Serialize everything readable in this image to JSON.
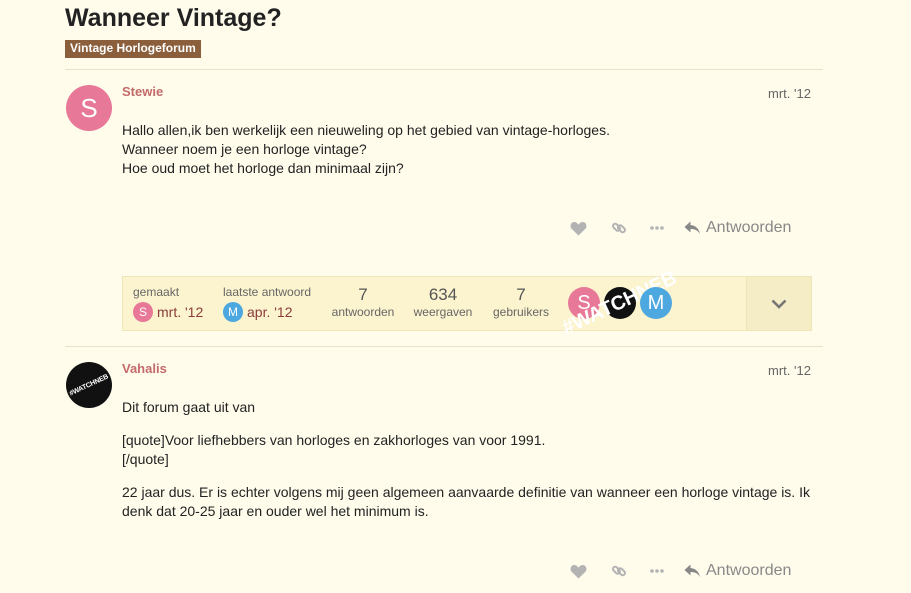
{
  "topic": {
    "title": "Wanneer Vintage?",
    "category": "Vintage Horlogeforum"
  },
  "posts": [
    {
      "author": "Stewie",
      "avatar_letter": "S",
      "date": "mrt. '12",
      "lines": [
        "Hallo allen,ik ben werkelijk een nieuweling op het gebied van vintage-horloges.",
        "Wanneer noem je een horloge vintage?",
        "Hoe oud moet het horloge dan minimaal zijn?"
      ],
      "reply_label": "Antwoorden"
    },
    {
      "author": "Vahalis",
      "avatar_text": "#WATCHNEB",
      "date": "mrt. '12",
      "paragraphs": [
        "Dit forum gaat uit van",
        "[quote]Voor liefhebbers van horloges en zakhorloges van voor 1991.",
        "[/quote]",
        "22 jaar dus. Er is echter volgens mij geen algemeen aanvaarde definitie van wanneer een horloge vintage is. Ik denk dat 20-25 jaar en ouder wel het minimum is."
      ],
      "reply_label": "Antwoorden"
    }
  ],
  "summary": {
    "created_label": "gemaakt",
    "created_avatar": "S",
    "created_date": "mrt. '12",
    "last_reply_label": "laatste antwoord",
    "last_reply_avatar": "M",
    "last_reply_date": "apr. '12",
    "replies_count": "7",
    "replies_label": "antwoorden",
    "views_count": "634",
    "views_label": "weergaven",
    "users_count": "7",
    "users_label": "gebruikers",
    "participants": [
      "S",
      "#WATCHNEB",
      "M"
    ]
  },
  "colors": {
    "background": "#fffcec",
    "category": "#8b5e3c",
    "username": "#c46a6a",
    "avatar_s": "#e87898",
    "avatar_m": "#4ea8e0"
  }
}
